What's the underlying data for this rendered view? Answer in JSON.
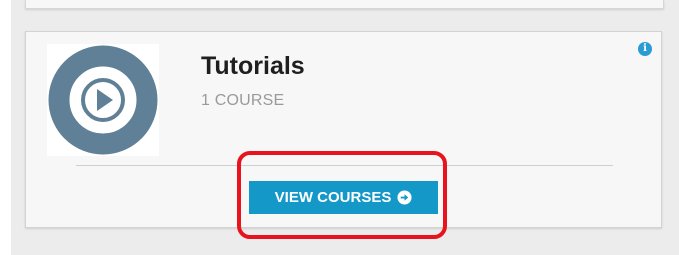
{
  "course_card": {
    "title": "Tutorials",
    "meta": "1 COURSE",
    "button_label": "VIEW COURSES",
    "thumbnail_icon": "play-circle-icon",
    "info_icon": "info-icon",
    "button_icon": "arrow-circle-right-icon"
  },
  "colors": {
    "button_bg": "#1498c7",
    "highlight": "#e8131c",
    "thumbnail_ring": "#5f8096",
    "info_icon": "#2a9bd3"
  }
}
